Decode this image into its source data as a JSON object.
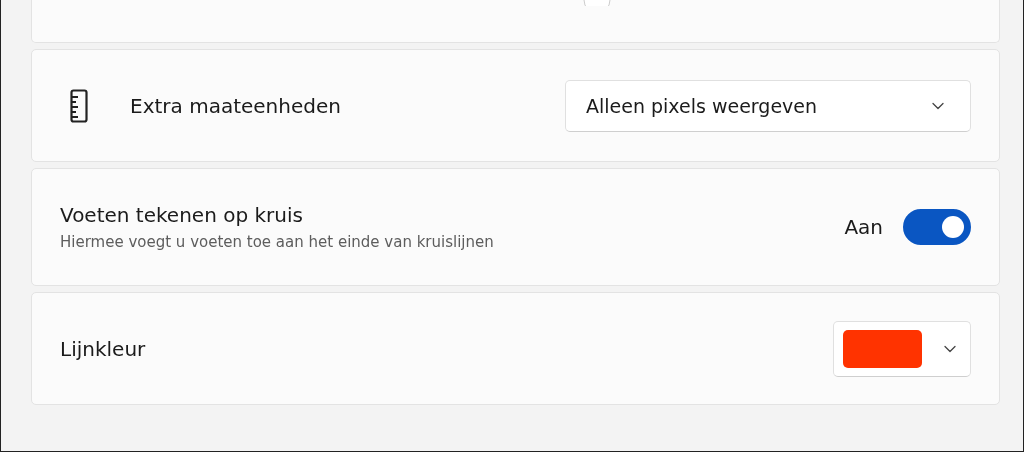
{
  "settings": [
    {
      "kind": "dropdown",
      "label": "Extra maateenheden",
      "value": "Alleen pixels weergeven"
    },
    {
      "kind": "toggle",
      "label": "Voeten tekenen op kruis",
      "description": "Hiermee voegt u voeten toe aan het einde van kruislijnen",
      "state_label": "Aan",
      "on": true
    },
    {
      "kind": "color",
      "label": "Lijnkleur",
      "color": "#ff3300"
    }
  ]
}
